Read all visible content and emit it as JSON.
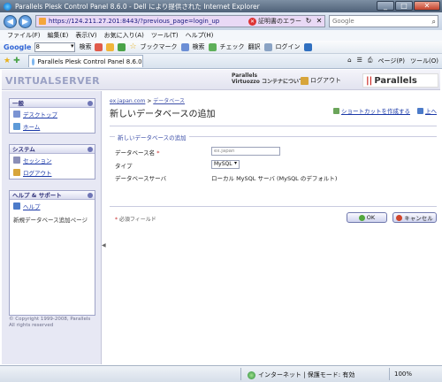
{
  "window": {
    "title": "Parallels Plesk Control Panel 8.6.0 - Dell により提供された Internet Explorer",
    "minimize": "_",
    "maximize": "□",
    "close": "✕"
  },
  "addressbar": {
    "back": "◀",
    "forward": "▶",
    "url": "https://124.211.27.201:8443/?previous_page=login_up",
    "cert_error": "証明書のエラー",
    "refresh": "↻",
    "stop": "✕",
    "search_placeholder": "Google",
    "search_icon": "⌕"
  },
  "menubar": {
    "items": [
      "ファイル(F)",
      "編集(E)",
      "表示(V)",
      "お気に入り(A)",
      "ツール(T)",
      "ヘルプ(H)"
    ]
  },
  "google_toolbar": {
    "logo": "Google",
    "box_value": "8",
    "search_label": "検索",
    "bookmarks": "ブックマーク",
    "search2": "検索",
    "check": "チェック",
    "translate": "翻訳",
    "login": "ログイン"
  },
  "favbar": {
    "tab_title": "Parallels Plesk Control Panel 8.6.0",
    "page_menu": "ページ(P)",
    "tools_menu": "ツール(O)"
  },
  "header": {
    "logo": "VIRTUALSERVER",
    "about_line1": "Parallels",
    "about_line2": "Virtuozzo コンテナについて",
    "logout": "ログアウト",
    "brand": "Parallels",
    "brand_bars": "||"
  },
  "sidebar": {
    "sections": [
      {
        "title": "一般",
        "items": [
          "デスクトップ",
          "ホーム"
        ]
      },
      {
        "title": "システム",
        "items": [
          "セッション",
          "ログアウト"
        ]
      },
      {
        "title": "ヘルプ & サポート",
        "items": [
          "ヘルプ"
        ],
        "text": "新規データベース追加ページ"
      }
    ],
    "copyright1": "© Copyright 1999-2008, Parallels",
    "copyright2": "All rights reserved"
  },
  "main": {
    "breadcrumb_domain": "ex.japan.com",
    "breadcrumb_sep": ">",
    "breadcrumb_db": "データベース",
    "title": "新しいデータベースの追加",
    "shortcut": "ショートカットを作成する",
    "up": "上へ",
    "legend": "新しいデータベースの追加",
    "field_name_label": "データベース名",
    "field_name_value": "ex.japan",
    "field_type_label": "タイプ",
    "field_type_value": "MySQL",
    "field_server_label": "データベースサーバ",
    "field_server_value": "ローカル MySQL サーバ (MySQL のデフォルト)",
    "required_note": "必須フィールド",
    "required_mark": "*",
    "ok": "OK",
    "cancel": "キャンセル"
  },
  "statusbar": {
    "zone": "インターネット | 保護モード: 有効",
    "zoom": "100%"
  }
}
